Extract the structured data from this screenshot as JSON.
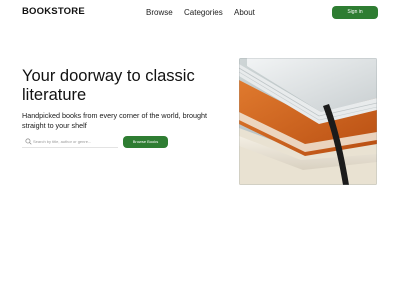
{
  "header": {
    "logo": "BOOKSTORE",
    "nav": [
      "Browse",
      "Categories",
      "About"
    ],
    "signin_label": "Sign in"
  },
  "hero": {
    "title": "Your doorway to classic literature",
    "subtitle": "Handpicked books from every corner of the world, brought straight to your shelf",
    "search_placeholder": "Search by title, author or genre...",
    "browse_label": "Browse Books",
    "image_icon": "stack-of-books-photo"
  },
  "colors": {
    "accent": "#2e7d32",
    "book_orange": "#d8641c",
    "book_cover": "#e9ecee",
    "bookmark": "#1b1b1b"
  }
}
